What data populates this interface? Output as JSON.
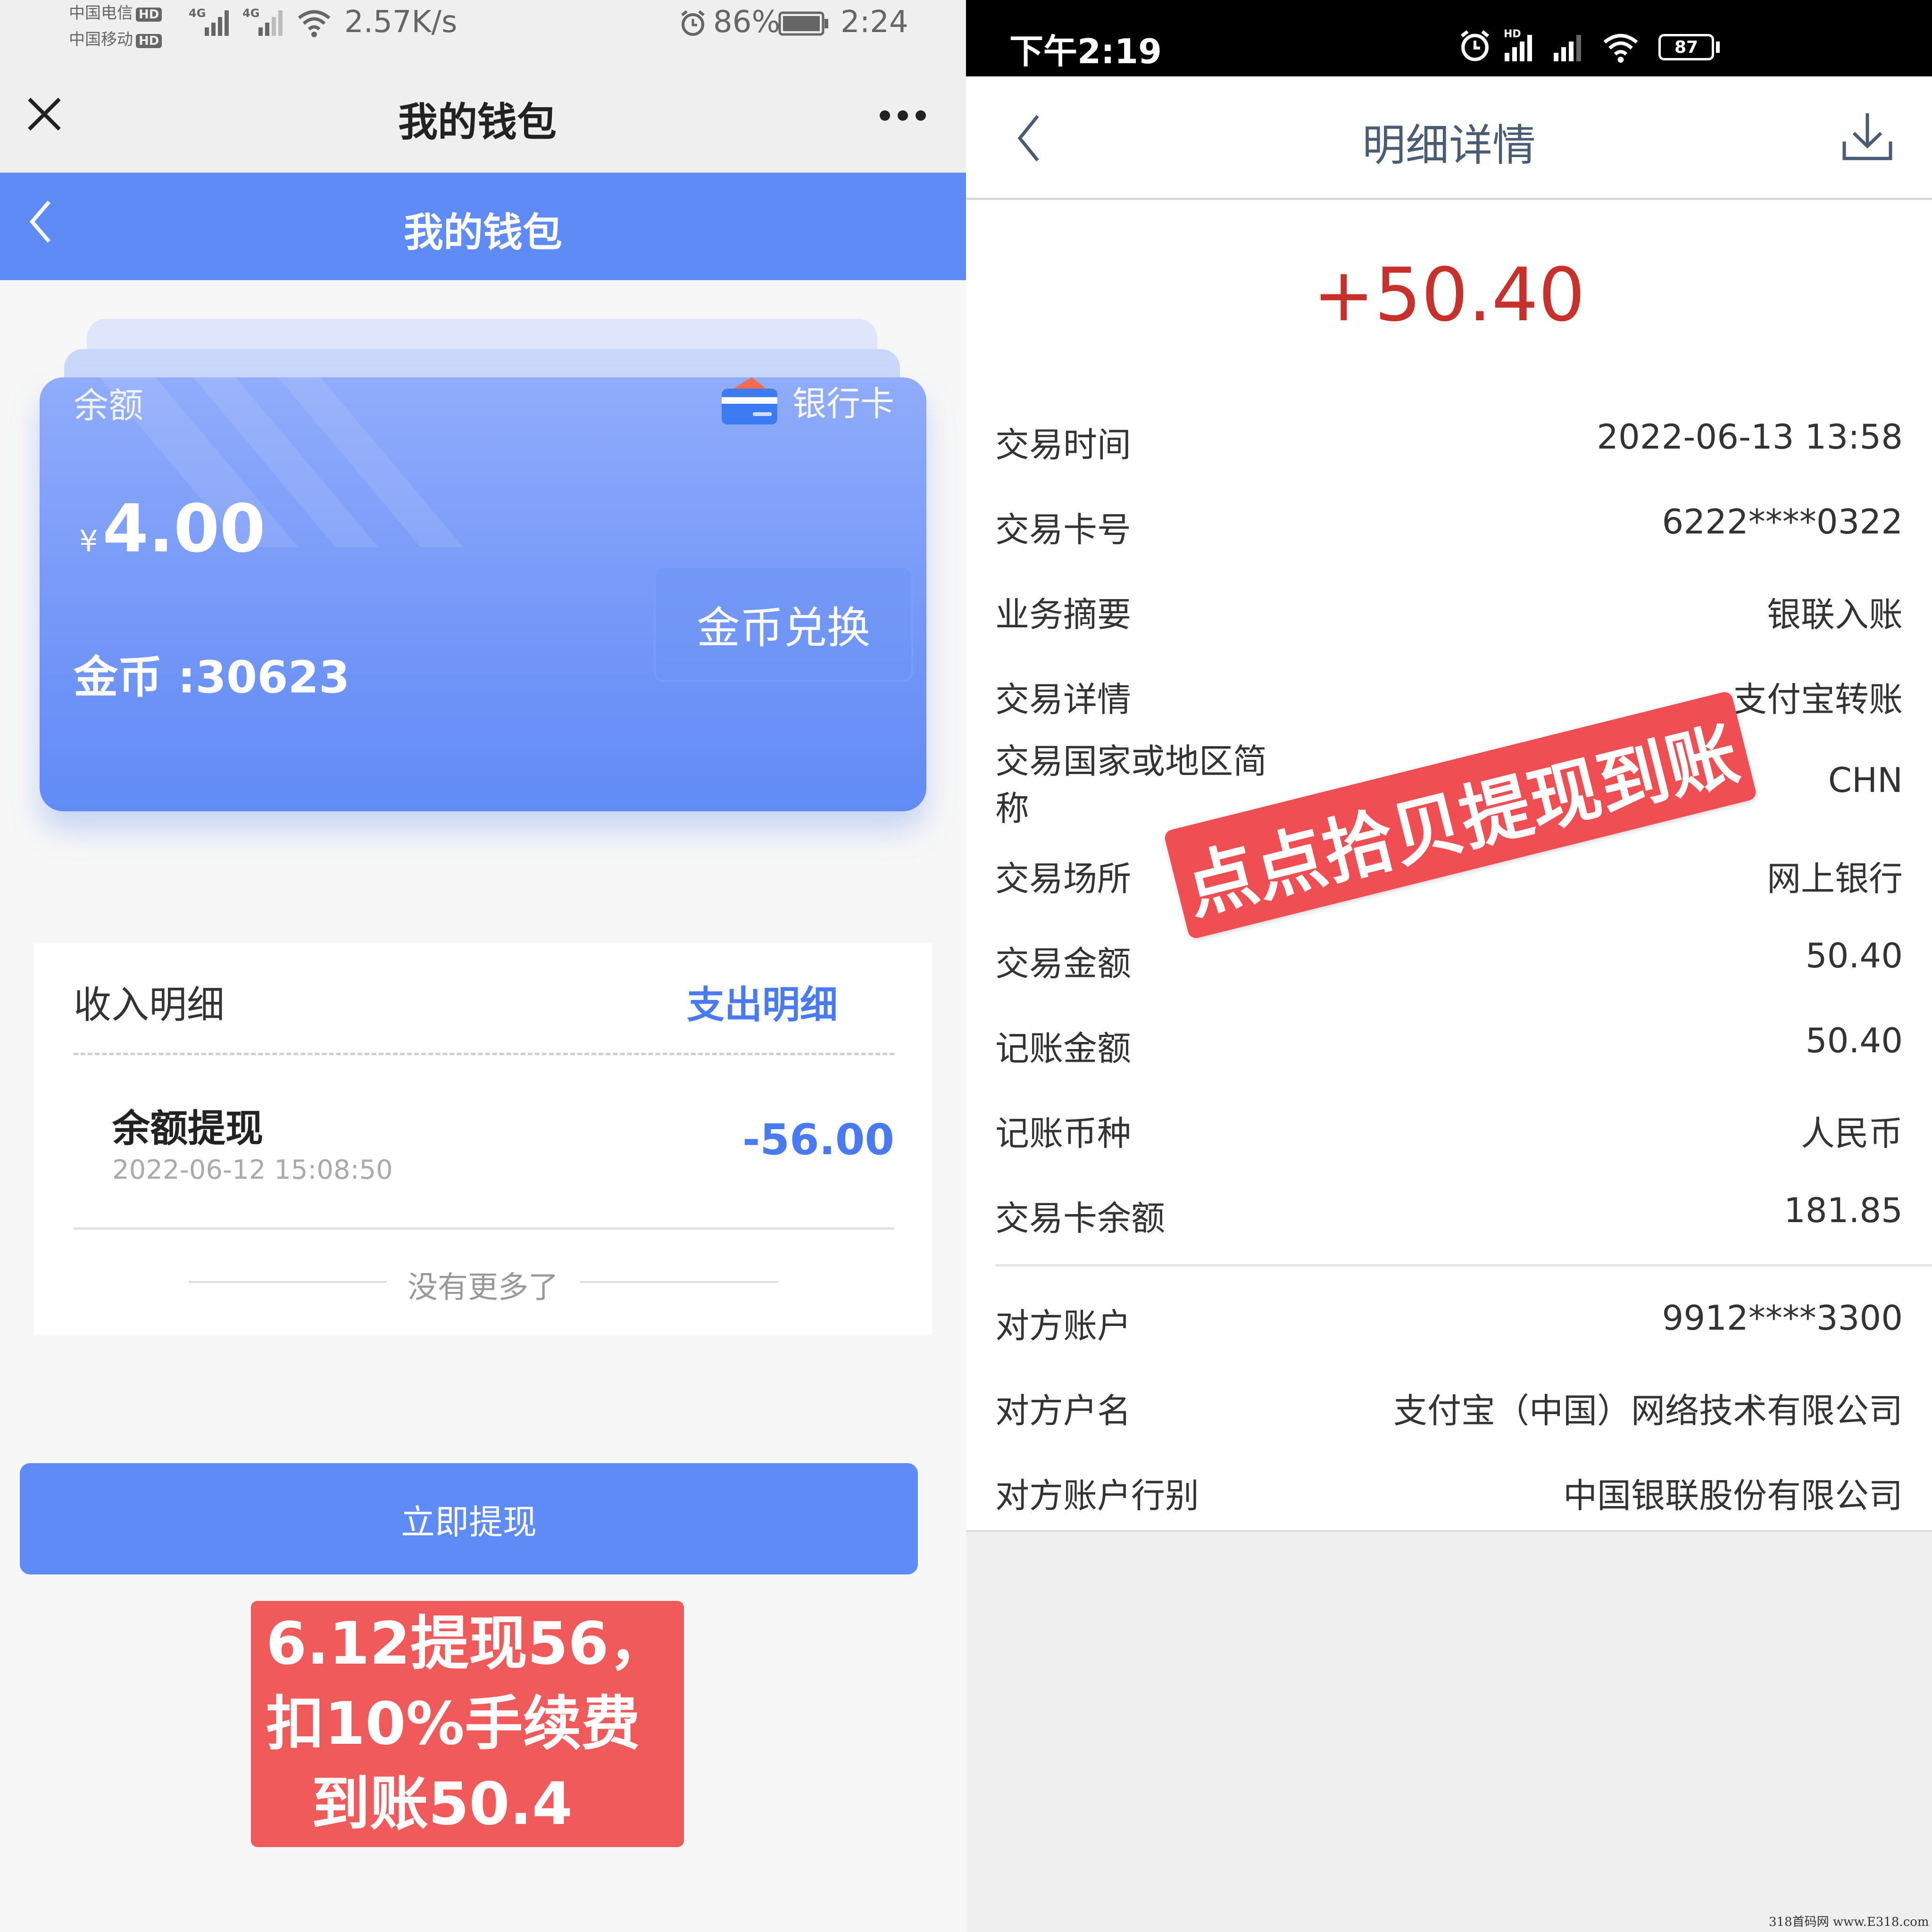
{
  "left_phone": {
    "status_bar": {
      "carrier1": "中国电信",
      "carrier2": "中国移动",
      "hd_badge": "HD",
      "net1": "4G",
      "net2": "4G",
      "speed": "2.57K/s",
      "battery": "86%",
      "time": "2:24"
    },
    "header": {
      "title": "我的钱包"
    },
    "blue_bar": {
      "title": "我的钱包"
    },
    "card": {
      "balance_label": "余额",
      "bank_card_label": "银行卡",
      "currency_symbol": "¥",
      "balance_value": "4.00",
      "coins_text": "金币 :30623",
      "exchange_button": "金币兑换"
    },
    "records": {
      "tab_income": "收入明细",
      "tab_expense": "支出明细",
      "items": [
        {
          "title": "余额提现",
          "time": "2022-06-12 15:08:50",
          "amount": "-56.00"
        }
      ],
      "no_more": "没有更多了"
    },
    "withdraw_button": "立即提现",
    "note_lines": [
      "6.12提现56，",
      "扣10%手续费",
      "到账50.4"
    ],
    "colors": {
      "primary": "#5f8bf7",
      "note_red": "#f05a5a"
    }
  },
  "right_phone": {
    "status_bar": {
      "time": "下午2:19",
      "hd_badge": "HD",
      "battery": "87"
    },
    "header": {
      "title": "明细详情"
    },
    "amount": "+50.40",
    "details": [
      {
        "label": "交易时间",
        "value": "2022-06-13 13:58"
      },
      {
        "label": "交易卡号",
        "value": "6222****0322"
      },
      {
        "label": "业务摘要",
        "value": "银联入账"
      },
      {
        "label": "交易详情",
        "value": "支付宝转账"
      },
      {
        "label": "交易国家或地区简称",
        "value": "CHN"
      },
      {
        "label": "交易场所",
        "value": "网上银行"
      },
      {
        "label": "交易金额",
        "value": "50.40"
      },
      {
        "label": "记账金额",
        "value": "50.40"
      },
      {
        "label": "记账币种",
        "value": "人民币"
      },
      {
        "label": "交易卡余额",
        "value": "181.85"
      }
    ],
    "counterparty": [
      {
        "label": "对方账户",
        "value": "9912****3300"
      },
      {
        "label": "对方户名",
        "value": "支付宝（中国）网络技术有限公司"
      },
      {
        "label": "对方账户行别",
        "value": "中国银联股份有限公司"
      }
    ],
    "stamp_text": "点点拾贝提现到账",
    "colors": {
      "amount_red": "#c8302c",
      "stamp_red": "#ef4e52"
    }
  },
  "watermark": "318首码网 www.E318.com"
}
